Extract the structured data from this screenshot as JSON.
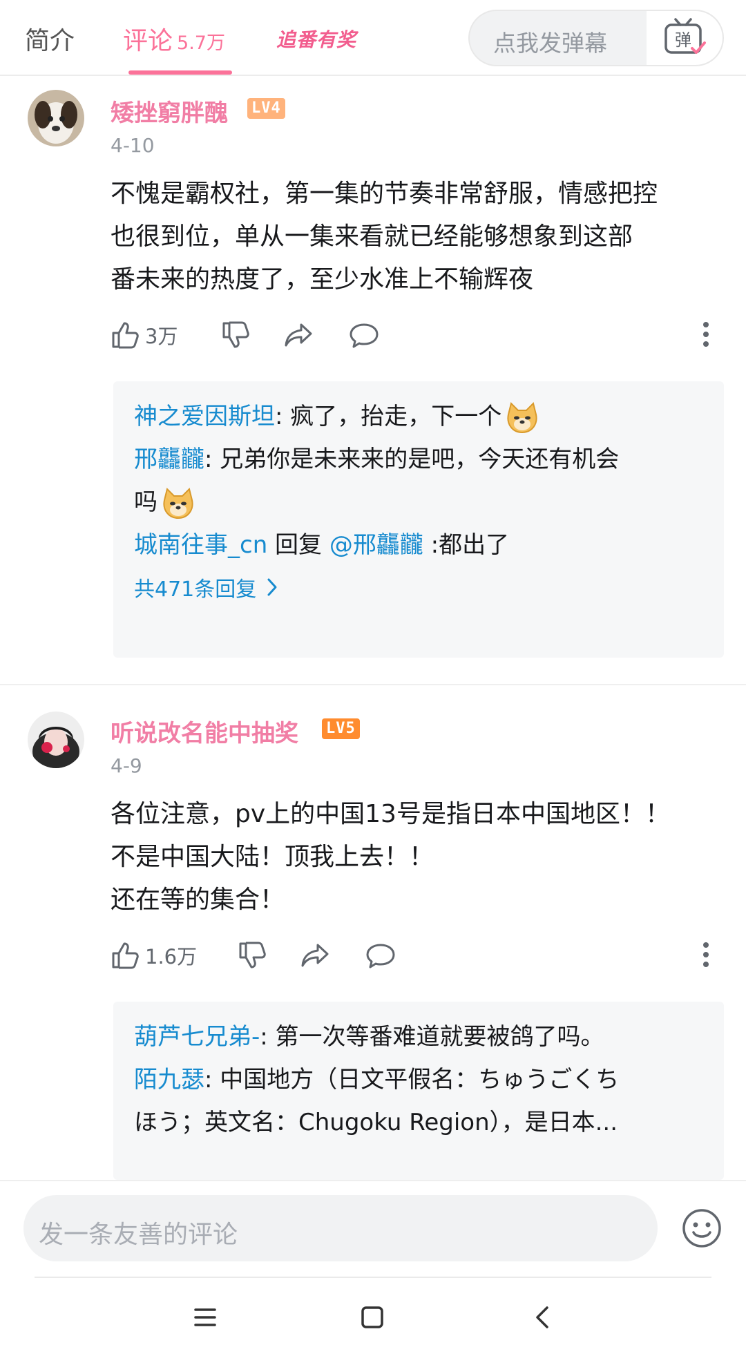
{
  "header": {
    "tab_intro": "简介",
    "tab_comments": "评论",
    "comment_count": "5.7万",
    "promo": "追番有奖",
    "danmaku_placeholder": "点我发弹幕",
    "danmaku_button": "弹"
  },
  "comments": [
    {
      "username": "矮挫窮胖醜",
      "level": "LV4",
      "date": "4-10",
      "content": "不愧是霸权社，第一集的节奏非常舒服，情感把控\n也很到位，单从一集来看就已经能够想象到这部\n番未来的热度了，至少水准上不输辉夜",
      "likes": "3万",
      "replies": [
        {
          "name": "神之爱因斯坦",
          "text": ": 疯了，抬走，下一个"
        },
        {
          "name": "邢龘龖",
          "text": ": 兄弟你是未来来的是吧，今天还有机会\n吗"
        },
        {
          "name": "城南往事_cn",
          "mid": " 回复 ",
          "mention": "@邢龘龖",
          "text": " :都出了"
        }
      ],
      "more_replies": "共471条回复"
    },
    {
      "username": "听说改名能中抽奖",
      "level": "LV5",
      "date": "4-9",
      "content": "各位注意，pv上的中国13号是指日本中国地区！！\n不是中国大陆！顶我上去！！\n还在等的集合！",
      "likes": "1.6万",
      "replies": [
        {
          "name": "葫芦七兄弟-",
          "text": ": 第一次等番难道就要被鸽了吗。"
        },
        {
          "name": "陌九瑟",
          "text": ": 中国地方（日文平假名：ちゅうごくち\nほう；英文名：Chugoku Region），是日本..."
        }
      ]
    }
  ],
  "bottom": {
    "input_placeholder": "发一条友善的评论"
  },
  "colors": {
    "accent": "#fb7299",
    "username": "#f17ea5",
    "reply_name": "#178bcf"
  }
}
